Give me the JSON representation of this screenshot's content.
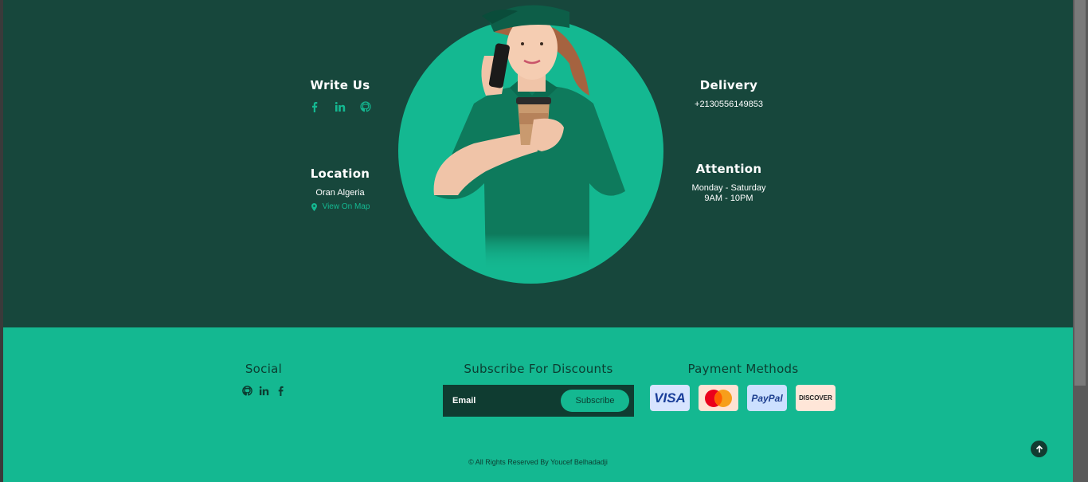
{
  "contact": {
    "write_us": {
      "title": "Write Us",
      "icons": [
        "facebook-icon",
        "linkedin-icon",
        "github-icon"
      ]
    },
    "location": {
      "title": "Location",
      "address": "Oran Algeria",
      "map_link": "View On Map"
    },
    "delivery": {
      "title": "Delivery",
      "phone": "+2130556149853"
    },
    "attention": {
      "title": "Attention",
      "days": "Monday - Saturday",
      "hours": "9AM - 10PM"
    }
  },
  "footer": {
    "social": {
      "title": "Social",
      "icons": [
        "github-icon",
        "linkedin-icon",
        "facebook-icon"
      ]
    },
    "subscribe": {
      "title": "Subscribe For Discounts",
      "email_placeholder": "Email",
      "button_label": "Subscribe"
    },
    "payment": {
      "title": "Payment Methods",
      "cards": [
        "VISA",
        "MasterCard",
        "PayPal",
        "DISCOVER"
      ]
    },
    "copyright": "© All Rights Reserved By Youcef Belhadadji"
  },
  "colors": {
    "dark_green": "#17473c",
    "accent": "#14b891",
    "footer_text": "#0c3d31"
  }
}
